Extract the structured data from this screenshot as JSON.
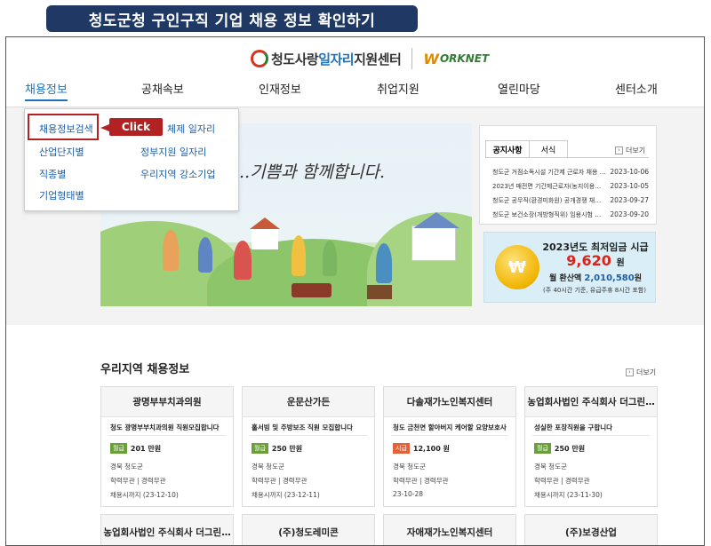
{
  "page_title": "청도군청 구인구직 기업 채용 정보 확인하기",
  "logo": {
    "prefix": "청도사랑",
    "highlight": "일자리",
    "suffix": "지원센터",
    "worknet": "ORKNET",
    "worknet_w": "W"
  },
  "nav": [
    "채용정보",
    "공채속보",
    "인재정보",
    "취업지원",
    "열린마당",
    "센터소개"
  ],
  "dropdown": {
    "left": [
      "채용정보검색",
      "산업단지별",
      "직종별",
      "기업형태별"
    ],
    "right": [
      "체제 일자리",
      "정부지원 일자리",
      "우리지역 강소기업"
    ]
  },
  "annotation": {
    "click_label": "Click"
  },
  "hero": {
    "text": "...기쁨과 함께합니다."
  },
  "notice": {
    "tabs": [
      "공지사항",
      "서식"
    ],
    "more": "더보기",
    "items": [
      {
        "title": "청도군 거점소독시설 기간제 근로자 채용 공고",
        "date": "2023-10-06"
      },
      {
        "title": "2023년 매전면 기간제근로자(농지이용조사) 채용",
        "date": "2023-10-05"
      },
      {
        "title": "청도군 공무직(환경미화원) 공개경쟁 채용 공고",
        "date": "2023-09-27"
      },
      {
        "title": "청도군 보건소장(개방형직위) 임용시험 계획 공고",
        "date": "2023-09-20"
      }
    ]
  },
  "wage": {
    "title": "2023년도 최저임금 시급",
    "amount": "9,620",
    "unit": "원",
    "month_label": "월 환산액",
    "month_amount": "2,010,580",
    "month_unit": "원",
    "note": "(주 40시간 기준, 유급주휴 8시간 포함)",
    "coin": "₩"
  },
  "regional": {
    "title": "우리지역 채용정보",
    "more": "더보기",
    "cards": [
      {
        "company": "광명부부치과의원",
        "subtitle": "청도 광명부부치과의원 직원모집합니다",
        "pay_type": "월급",
        "pay": "201 만원",
        "location": "경북 청도군",
        "requirement": "학력무관 | 경력무관",
        "deadline": "채용시까지 (23-12-10)"
      },
      {
        "company": "운문산가든",
        "subtitle": "홀서빙 및 주방보조 직원 모집합니다",
        "pay_type": "월급",
        "pay": "250 만원",
        "location": "경북 청도군",
        "requirement": "학력무관 | 경력무관",
        "deadline": "채용시까지 (23-12-11)"
      },
      {
        "company": "다솔재가노인복지센터",
        "subtitle": "청도 금천면 할아버지 케어할 요양보호사",
        "pay_type": "시급",
        "pay": "12,100 원",
        "location": "경북 청도군",
        "requirement": "학력무관 | 경력무관",
        "deadline": "23-10-28"
      },
      {
        "company": "농업회사법인 주식회사 더그린…",
        "subtitle": "성실한 포장직원을 구합니다",
        "pay_type": "월급",
        "pay": "250 만원",
        "location": "경북 청도군",
        "requirement": "학력무관 | 경력무관",
        "deadline": "채용시까지 (23-11-30)"
      }
    ],
    "cards_row2": [
      "농업회사법인 주식회사 더그린…",
      "(주)청도레미콘",
      "자애재가노인복지센터",
      "(주)보경산업"
    ]
  }
}
